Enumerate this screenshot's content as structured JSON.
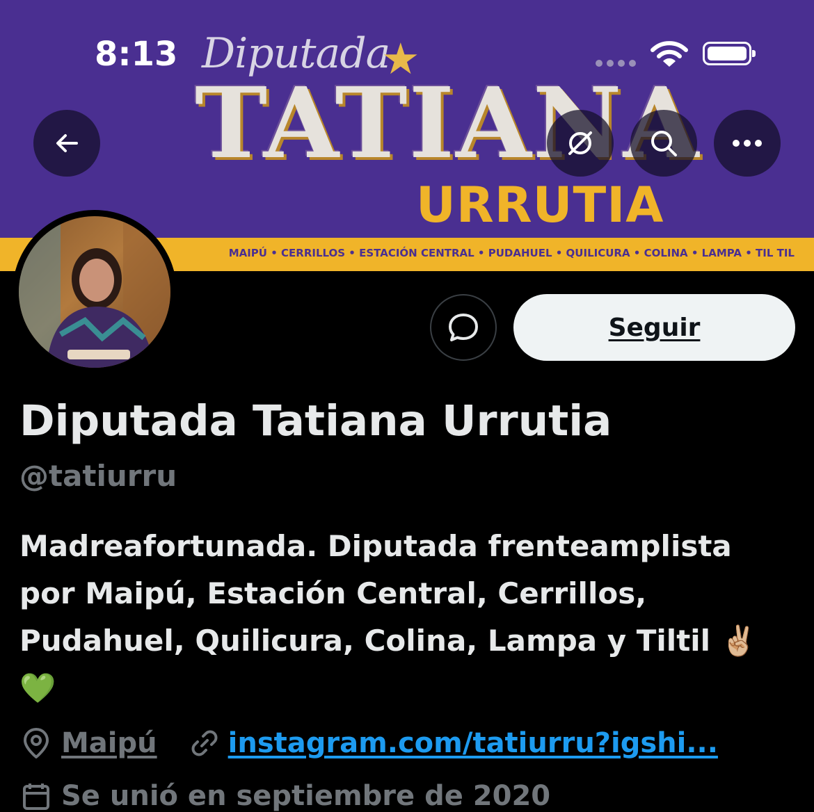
{
  "status_bar": {
    "time": "8:13"
  },
  "banner": {
    "kicker": "Diputada",
    "name": "TATIANA",
    "surname": "URRUTIA",
    "districts": "MAIPÚ • CERRILLOS • ESTACIÓN CENTRAL • PUDAHUEL • QUILICURA • COLINA • LAMPA • TIL TIL",
    "background_color": "#4a2f91",
    "accent_color": "#f0b429"
  },
  "nav": {
    "back_icon": "arrow-left-icon",
    "translate_icon": "translate-off-icon",
    "search_icon": "search-icon",
    "more_icon": "more-horizontal-icon"
  },
  "actions": {
    "message_icon": "message-bubble-icon",
    "follow_label": "Seguir"
  },
  "profile": {
    "display_name": "Diputada Tatiana Urrutia",
    "handle": "@tatiurru",
    "bio_text": "Madreafortunada. Diputada frenteamplista por Maipú, Estación Central, Cerrillos, Pudahuel, Quilicura, Colina, Lampa y Tiltil",
    "bio_emoji_1": "✌🏼",
    "bio_emoji_2": "💚",
    "location": "Maipú",
    "website": "instagram.com/tatiurru?igshi...",
    "joined": "Se unió en septiembre de 2020",
    "link_color": "#1d9bf0",
    "secondary_text_color": "#71767b"
  }
}
